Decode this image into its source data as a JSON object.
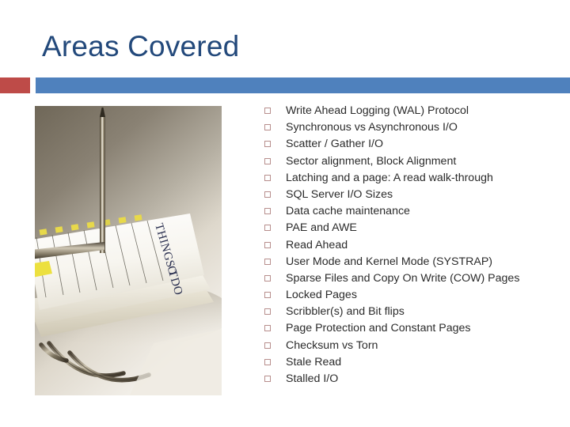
{
  "slide": {
    "title": "Areas Covered",
    "accent_red": "#BE4B48",
    "accent_blue": "#4F81BD",
    "title_color": "#23497B",
    "bullet_marker_color": "#B78E8C",
    "body_text_color": "#2b2b2b"
  },
  "photo": {
    "alt": "Photograph of a 'Things To Do' notepad with yellow checkbox squares, a metal pen and wire binder rings on pale paper stack",
    "notepad_heading": "THINGS TO DO"
  },
  "bullets": [
    "Write Ahead Logging (WAL) Protocol",
    "Synchronous vs Asynchronous I/O",
    "Scatter / Gather I/O",
    "Sector alignment, Block Alignment",
    "Latching and a page:   A read walk-through",
    "SQL Server I/O Sizes",
    "Data cache maintenance",
    "PAE and AWE",
    "Read Ahead",
    "User Mode and Kernel Mode  (SYSTRAP)",
    "Sparse Files and Copy On Write (COW) Pages",
    "Locked Pages",
    "Scribbler(s) and Bit flips",
    "Page Protection and Constant Pages",
    "Checksum vs Torn",
    "Stale Read",
    "Stalled I/O"
  ]
}
